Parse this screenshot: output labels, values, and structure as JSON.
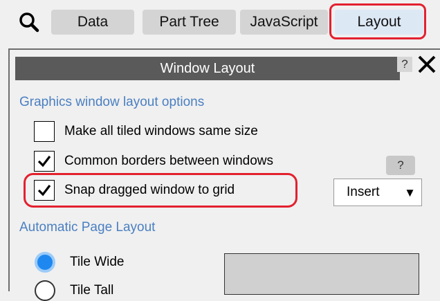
{
  "toolbar": {
    "search_icon": "magnifier-icon",
    "tabs": [
      {
        "label": "Data"
      },
      {
        "label": "Part Tree"
      },
      {
        "label": "JavaScript"
      },
      {
        "label": "Layout",
        "active": true
      }
    ]
  },
  "panel": {
    "title": "Window Layout",
    "help_mini": "?",
    "close_icon": "close-icon",
    "section1": {
      "heading": "Graphics window layout options",
      "options": [
        {
          "label": "Make all tiled windows same size",
          "checked": false
        },
        {
          "label": "Common borders between windows",
          "checked": true
        },
        {
          "label": "Snap dragged window to grid",
          "checked": true
        }
      ],
      "help_button": "?",
      "dropdown": {
        "value": "Insert",
        "arrow": "▼"
      }
    },
    "section2": {
      "heading": "Automatic Page Layout",
      "radios": [
        {
          "label": "Tile Wide",
          "selected": true
        },
        {
          "label": "Tile Tall",
          "selected": false
        }
      ]
    }
  },
  "colors": {
    "highlight": "#e3202f",
    "section_heading": "#4a7fc1",
    "title_bar": "#5a5a5a",
    "radio_selected": "#1e88f0",
    "active_tab": "#dde8f5"
  }
}
